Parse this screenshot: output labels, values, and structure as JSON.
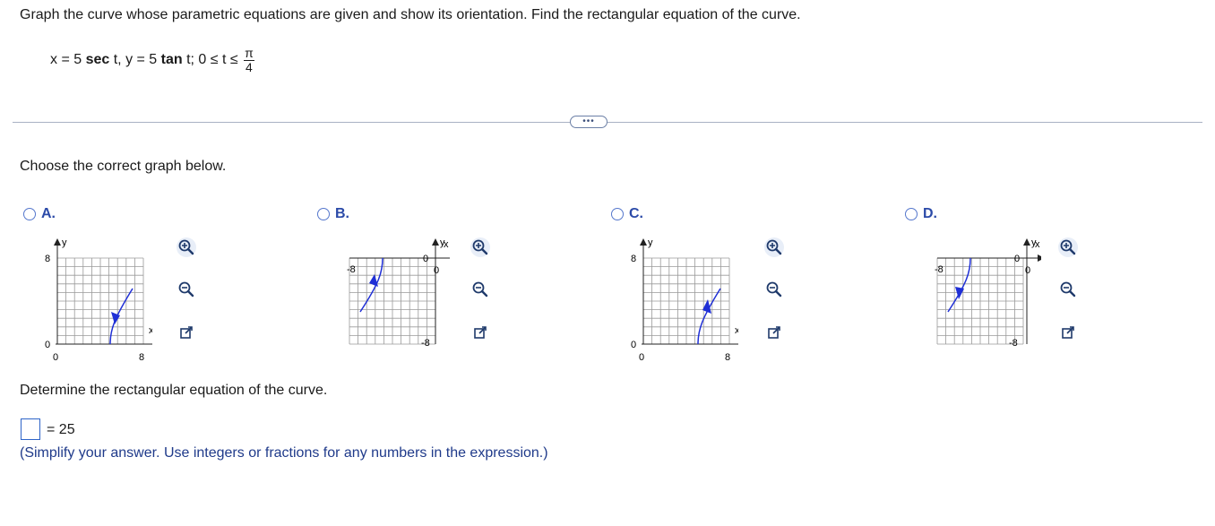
{
  "question": {
    "prompt": "Graph the curve whose parametric equations are given and show its orientation. Find the rectangular equation of the curve.",
    "equation_part1": "x = 5 ",
    "sec_label": "sec",
    "equation_part2": " t, y = 5 ",
    "tan_label": "tan",
    "equation_part3": " t; 0 ≤ t ≤ ",
    "frac_num": "π",
    "frac_den": "4"
  },
  "more_button": "•••",
  "choose_label": "Choose the correct graph below.",
  "options": [
    {
      "letter": "A.",
      "axis_labels": {
        "y": "y",
        "x": "x",
        "top": "8",
        "origin": "0",
        "origin_x": "0",
        "right": "8"
      }
    },
    {
      "letter": "B.",
      "axis_labels": {
        "y": "y",
        "x": "x",
        "top": "0",
        "left": "-8",
        "bottom": "-8",
        "origin": "0"
      }
    },
    {
      "letter": "C.",
      "axis_labels": {
        "y": "y",
        "x": "x",
        "top": "8",
        "origin": "0",
        "origin_x": "0",
        "right": "8"
      }
    },
    {
      "letter": "D.",
      "axis_labels": {
        "y": "y",
        "x": "x",
        "top": "0",
        "left": "-8",
        "bottom": "-8",
        "origin": "0"
      }
    }
  ],
  "tools": {
    "zoom_in": "zoom-in-icon",
    "zoom_out": "zoom-out-icon",
    "popout": "popout-icon"
  },
  "colors": {
    "curve": "#1f2fd6",
    "accent": "#2b4aa8",
    "grid": "#9a9a9a"
  },
  "determine_label": "Determine the rectangular equation of the curve.",
  "answer": {
    "value": "",
    "rhs": "= 25"
  },
  "hint": "(Simplify your answer. Use integers or fractions for any numbers in the expression.)"
}
